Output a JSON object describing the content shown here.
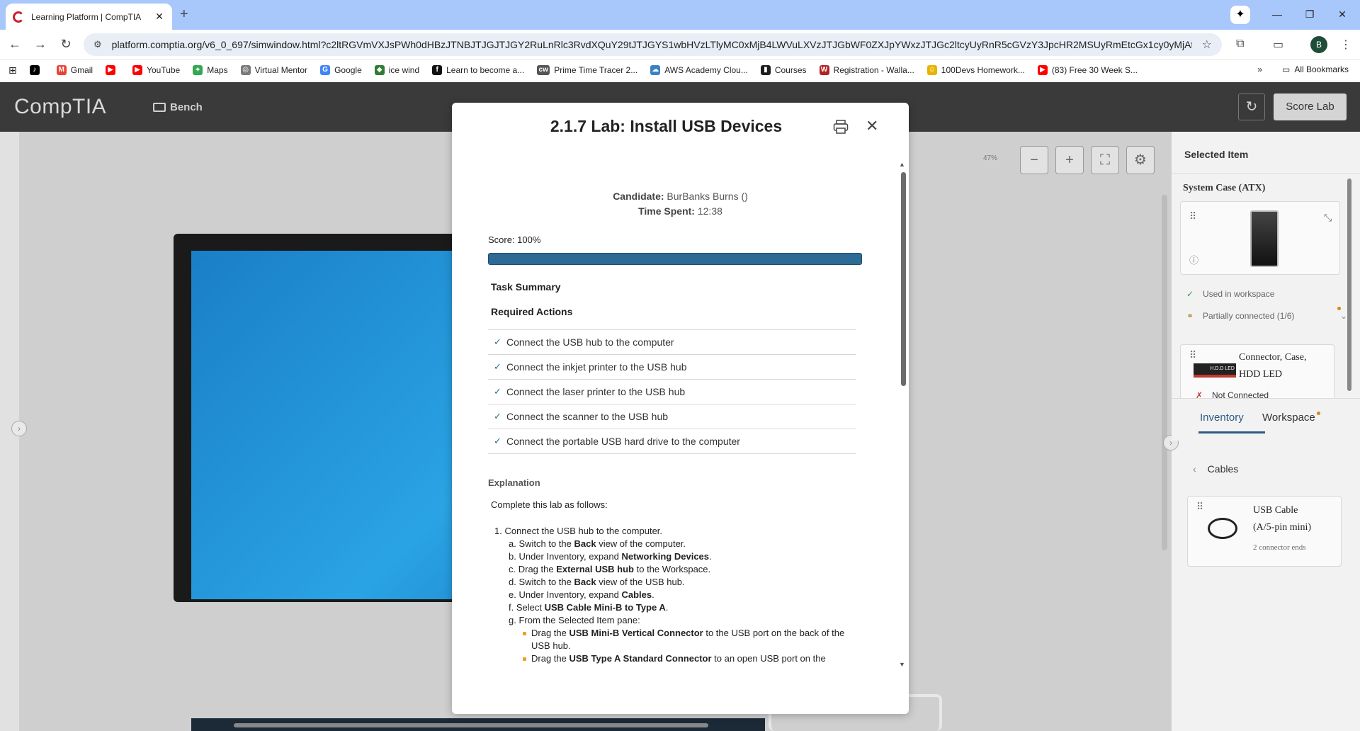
{
  "browser": {
    "tab_title": "Learning Platform | CompTIA",
    "tab_close": "✕",
    "new_tab": "+",
    "url": "platform.comptia.org/v6_0_697/simwindow.html?c2ltRGVmVXJsPWh0dHBzJTNBJTJGJTJGY2RuLnRlc3RvdXQuY29tJTJGYS1wbHVzLTlyMC0xMjB4LWVuLXVzJTJGbWF0ZXJpYWxzJTJGc2ltcyUyRnR5cGVzY3JpcHR2MSUyRmEtcGx1cy0yMjAtMTIweC1sYWJ...",
    "profile_initial": "B",
    "bookmarks": [
      {
        "label": "",
        "icon": "tiktok-icon",
        "color": "#000000"
      },
      {
        "label": "Gmail",
        "icon": "gmail-icon",
        "color": "#ea4335"
      },
      {
        "label": "",
        "icon": "youtube-icon",
        "color": "#ff0000"
      },
      {
        "label": "YouTube",
        "icon": "youtube-icon",
        "color": "#ff0000"
      },
      {
        "label": "Maps",
        "icon": "maps-icon",
        "color": "#34a853"
      },
      {
        "label": "Virtual Mentor",
        "icon": "mentor-icon",
        "color": "#7a7a7a"
      },
      {
        "label": "Google",
        "icon": "google-icon",
        "color": "#4285f4"
      },
      {
        "label": "ice wind",
        "icon": "shield-icon",
        "color": "#2e7d32"
      },
      {
        "label": "Learn to become a...",
        "icon": "learn-icon",
        "color": "#111111"
      },
      {
        "label": "Prime Time Tracer 2...",
        "icon": "cw-icon",
        "color": "#555555"
      },
      {
        "label": "AWS Academy Clou...",
        "icon": "cloud-icon",
        "color": "#3b82c4"
      },
      {
        "label": "Courses",
        "icon": "chart-icon",
        "color": "#1d1d1d"
      },
      {
        "label": "Registration - Walla...",
        "icon": "w-icon",
        "color": "#b22222"
      },
      {
        "label": "100Devs Homework...",
        "icon": "emoji-icon",
        "color": "#e8b400"
      },
      {
        "label": "(83) Free 30 Week S...",
        "icon": "youtube-icon",
        "color": "#ff0000"
      }
    ],
    "more_bookmarks": "»",
    "all_bookmarks": "All Bookmarks"
  },
  "app": {
    "logo": "CompTIA",
    "bench_label": "Bench",
    "score_lab": "Score Lab",
    "zoom_level": "47%"
  },
  "right_panel": {
    "title": "Selected Item",
    "item_name": "System Case (ATX)",
    "used_status": "Used in workspace",
    "connected_status": "Partially connected (1/6)",
    "connector_name": "Connector, Case, HDD LED",
    "connector_led_text": "H.D.D LED",
    "connector_status": "Not Connected",
    "tabs": [
      "Inventory",
      "Workspace"
    ],
    "breadcrumb": "Cables",
    "cable_name": "USB Cable (A/5-pin mini)",
    "cable_sub": "2 connector ends"
  },
  "modal": {
    "title": "2.1.7 Lab: Install USB Devices",
    "candidate_label": "Candidate:",
    "candidate_value": "BurBanks Burns ()",
    "time_label": "Time Spent:",
    "time_value": "12:38",
    "score_text": "Score: 100%",
    "score_fraction": 1.0,
    "task_summary": "Task Summary",
    "required_actions": "Required Actions",
    "actions": [
      "Connect the USB hub to the computer",
      "Connect the inkjet printer to the USB hub",
      "Connect the laser printer to the USB hub",
      "Connect the scanner to the USB hub",
      "Connect the portable USB hard drive to the computer"
    ],
    "explanation_heading": "Explanation",
    "explanation_intro": "Complete this lab as follows:",
    "steps": {
      "s1": "1. Connect the USB hub to the computer.",
      "a_pre": "a. Switch to the ",
      "a_b": "Back",
      "a_post": " view of the computer.",
      "b_pre": "b. Under Inventory, expand ",
      "b_b": "Networking Devices",
      "b_post": ".",
      "c_pre": "c. Drag the ",
      "c_b": "External USB hub",
      "c_post": " to the Workspace.",
      "d_pre": "d. Switch to the ",
      "d_b": "Back",
      "d_post": " view of the USB hub.",
      "e_pre": "e. Under Inventory, expand ",
      "e_b": "Cables",
      "e_post": ".",
      "f_pre": "f. Select ",
      "f_b": "USB Cable Mini-B to Type A",
      "f_post": ".",
      "g": "g. From the Selected Item pane:",
      "g1_pre": "Drag the ",
      "g1_b": "USB Mini-B Vertical Connector",
      "g1_post": " to the USB port on the back of the USB hub.",
      "g2_pre": "Drag the ",
      "g2_b": "USB Type A Standard Connector",
      "g2_post": " to an open USB port on the"
    }
  },
  "colors": {
    "tabstrip": "#a8c7fa",
    "app_header": "#3a3a3a",
    "score_fill": "#2d6a96",
    "check": "#2c6e92",
    "bullet": "#f0a020"
  }
}
